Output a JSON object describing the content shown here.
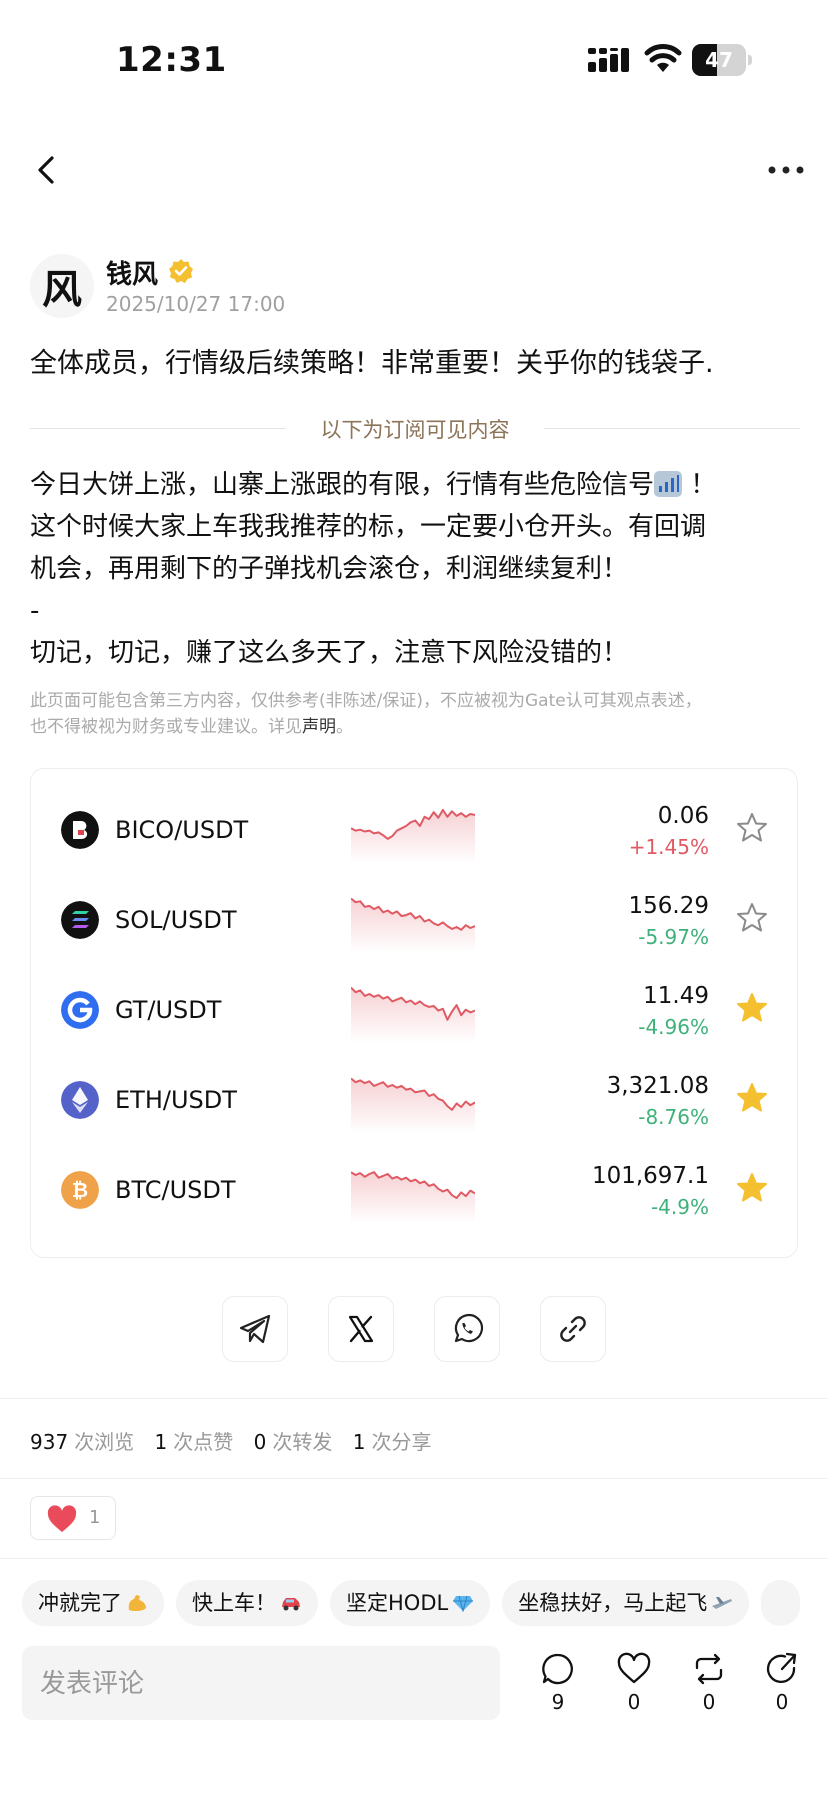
{
  "status_bar": {
    "time": "12:31",
    "battery": "47",
    "battery_level": 0.47
  },
  "author": {
    "avatar_char": "风",
    "name": "钱风",
    "date": "2025/10/27 17:00"
  },
  "post": {
    "title": "全体成员，行情级后续策略！非常重要！关乎你的钱袋子.",
    "subscription_divider": "以下为订阅可见内容",
    "body": {
      "line1_a": "今日大饼上涨，山寨上涨跟的有限，行情有些危险信号",
      "line1_b": "！",
      "line2": "这个时候大家上车我我推荐的标，一定要小仓开头。有回调",
      "line3": "机会，再用剩下的子弹找机会滚仓，利润继续复利！",
      "line4": "-",
      "line5": "切记，切记，赚了这么多天了，注意下风险没错的！"
    },
    "disclaimer_a": "此页面可能包含第三方内容，仅供参考(非陈述/保证)，不应被视为Gate认可其观点表述，",
    "disclaimer_b": "也不得被视为财务或专业建议。详见",
    "disclaimer_link": "声明",
    "disclaimer_end": "。"
  },
  "markets": [
    {
      "pair": "BICO/USDT",
      "price": "0.06",
      "change": "+1.45%",
      "direction": "up",
      "starred": false,
      "icon": "bico-logo",
      "color": "#e05a64",
      "spark": [
        0.55,
        0.6,
        0.58,
        0.62,
        0.6,
        0.66,
        0.64,
        0.7,
        0.78,
        0.72,
        0.6,
        0.55,
        0.5,
        0.42,
        0.38,
        0.5,
        0.3,
        0.35,
        0.2,
        0.32,
        0.15,
        0.3,
        0.18,
        0.28,
        0.22,
        0.3,
        0.24,
        0.26
      ]
    },
    {
      "pair": "SOL/USDT",
      "price": "156.29",
      "change": "-5.97%",
      "direction": "down",
      "starred": false,
      "icon": "sol-logo",
      "color": "#e05a64",
      "spark": [
        0.12,
        0.2,
        0.18,
        0.3,
        0.28,
        0.35,
        0.3,
        0.42,
        0.38,
        0.45,
        0.4,
        0.5,
        0.48,
        0.44,
        0.55,
        0.5,
        0.62,
        0.58,
        0.66,
        0.7,
        0.64,
        0.72,
        0.78,
        0.74,
        0.8,
        0.7,
        0.76,
        0.72
      ]
    },
    {
      "pair": "GT/USDT",
      "price": "11.49",
      "change": "-4.96%",
      "direction": "down",
      "starred": true,
      "icon": "gt-logo",
      "color": "#e05a64",
      "spark": [
        0.1,
        0.2,
        0.16,
        0.28,
        0.24,
        0.3,
        0.26,
        0.34,
        0.3,
        0.4,
        0.36,
        0.32,
        0.42,
        0.38,
        0.46,
        0.4,
        0.48,
        0.52,
        0.5,
        0.6,
        0.56,
        0.8,
        0.62,
        0.48,
        0.7,
        0.58,
        0.64,
        0.6
      ]
    },
    {
      "pair": "ETH/USDT",
      "price": "3,321.08",
      "change": "-8.76%",
      "direction": "down",
      "starred": true,
      "icon": "eth-logo",
      "color": "#e05a64",
      "spark": [
        0.12,
        0.2,
        0.16,
        0.22,
        0.18,
        0.28,
        0.24,
        0.2,
        0.3,
        0.26,
        0.32,
        0.28,
        0.36,
        0.34,
        0.42,
        0.4,
        0.38,
        0.5,
        0.46,
        0.56,
        0.6,
        0.72,
        0.8,
        0.66,
        0.74,
        0.62,
        0.7,
        0.64
      ]
    },
    {
      "pair": "BTC/USDT",
      "price": "101,697.1",
      "change": "-4.9%",
      "direction": "down",
      "starred": true,
      "icon": "btc-logo",
      "color": "#e05a64",
      "spark": [
        0.2,
        0.26,
        0.22,
        0.3,
        0.24,
        0.2,
        0.32,
        0.28,
        0.24,
        0.34,
        0.3,
        0.36,
        0.32,
        0.4,
        0.36,
        0.44,
        0.4,
        0.5,
        0.46,
        0.56,
        0.62,
        0.58,
        0.7,
        0.76,
        0.64,
        0.72,
        0.6,
        0.66
      ]
    }
  ],
  "share": [
    {
      "name": "telegram-share-button",
      "icon": "telegram-icon"
    },
    {
      "name": "x-share-button",
      "icon": "x-icon"
    },
    {
      "name": "whatsapp-share-button",
      "icon": "whatsapp-icon"
    },
    {
      "name": "copy-link-button",
      "icon": "link-icon"
    }
  ],
  "stats": {
    "views": "937",
    "views_label": "次浏览",
    "likes": "1",
    "likes_label": "次点赞",
    "reposts": "0",
    "reposts_label": "次转发",
    "shares": "1",
    "shares_label": "次分享"
  },
  "reaction": {
    "icon": "heart-icon",
    "count": "1"
  },
  "quick_replies": [
    {
      "text": "冲就完了",
      "emoji": "muscle-emoji"
    },
    {
      "text": "快上车！",
      "emoji": "car-emoji"
    },
    {
      "text": "坚定HODL",
      "emoji": "diamond-emoji"
    },
    {
      "text": "坐稳扶好，马上起飞",
      "emoji": "airplane-emoji"
    }
  ],
  "comment": {
    "placeholder": "发表评论"
  },
  "actions": [
    {
      "name": "comment",
      "icon": "comment-icon",
      "count": "9"
    },
    {
      "name": "like",
      "icon": "heart-outline-icon",
      "count": "0"
    },
    {
      "name": "repost",
      "icon": "repost-icon",
      "count": "0"
    },
    {
      "name": "share",
      "icon": "share-icon",
      "count": "0"
    }
  ],
  "colors": {
    "accent_gold": "#f5c02f",
    "up": "#e05a64",
    "down": "#3fb17a",
    "divider_text": "#8b7458"
  }
}
